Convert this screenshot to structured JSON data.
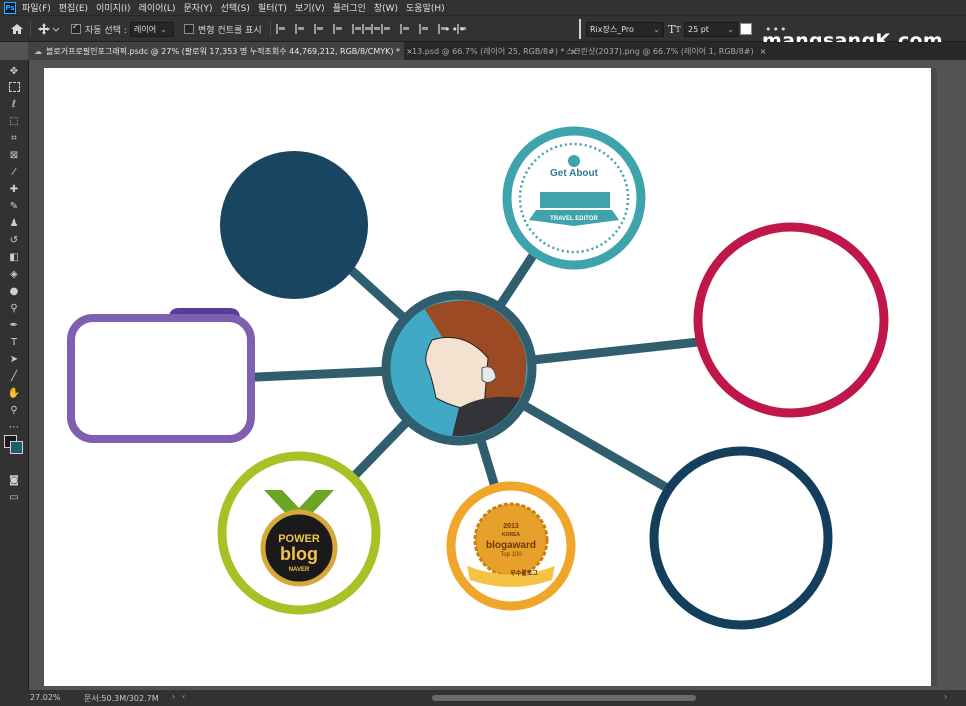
{
  "app": {
    "logo_text": "Ps"
  },
  "menu": [
    "파일(F)",
    "편집(E)",
    "이미지(I)",
    "레이어(L)",
    "문자(Y)",
    "선택(S)",
    "필터(T)",
    "보기(V)",
    "플러그인",
    "창(W)",
    "도움말(H)"
  ],
  "options": {
    "auto_select_label": "자동 선택 :",
    "auto_select_value": "레이어",
    "transform_label": "변형 컨트롤 표시",
    "font_name": "Rix장스_Pro",
    "font_size": "25 pt",
    "more": "•••"
  },
  "tabs": [
    {
      "label": "블로거프로필인포그래픽.psdc @ 27% (팔로워  17,353 명  누적조회수 44,769,212, RGB/8/CMYK) *",
      "close": "×"
    },
    {
      "label": "13.psd @ 66.7% (레이어 25, RGB/8#) *",
      "close": "×"
    },
    {
      "label": "스크린샷(2037).png @ 66.7% (레이어 1, RGB/8#)",
      "close": "×"
    }
  ],
  "watermark": "mangsangK.com",
  "status": {
    "zoom": "27.02%",
    "doc_info": "문서:50.3M/302.7M"
  },
  "canvas": {
    "badge_travel": {
      "brand": "Get About",
      "ribbon": "TRAVEL EDITOR"
    },
    "badge_power": {
      "line1": "POWER",
      "line2": "blog",
      "line3": "NAVER"
    },
    "badge_award": {
      "year": "2013",
      "line1": "KOREA",
      "line2": "blogaward",
      "line3": "Top 100",
      "ribbon": "우수블로그"
    }
  },
  "colors": {
    "dark_navy": "#1a4560",
    "teal_line": "#2f5f6e",
    "teal_badge": "#3ea3ad",
    "crimson": "#c0174a",
    "purple": "#7e5fb0",
    "lime": "#a9c027",
    "orange": "#f0a52b",
    "deep_navy": "#143f5c",
    "center_bg": "#41a9c6"
  }
}
